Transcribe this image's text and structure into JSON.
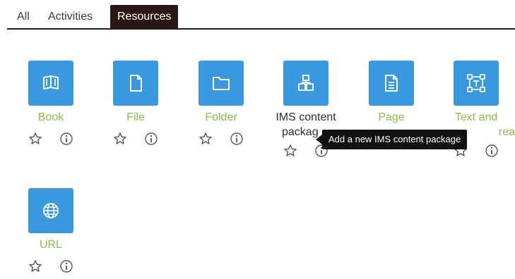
{
  "tabs": [
    {
      "label": "All"
    },
    {
      "label": "Activities"
    },
    {
      "label": "Resources"
    }
  ],
  "active_tab": "Resources",
  "tiles": [
    {
      "label": "Book",
      "icon": "book-icon"
    },
    {
      "label": "File",
      "icon": "file-icon"
    },
    {
      "label": "Folder",
      "icon": "folder-icon"
    },
    {
      "label_line1": "IMS content",
      "label_line2": "packag",
      "icon": "ims-package-icon"
    },
    {
      "label": "Page",
      "icon": "page-icon"
    },
    {
      "label_line1": "Text and",
      "label_line2": "rea",
      "icon": "text-area-icon"
    },
    {
      "label": "URL",
      "icon": "globe-icon"
    }
  ],
  "action_icons": [
    "star-outline-icon",
    "info-circle-icon"
  ],
  "tooltip": {
    "text": "Add a new IMS content package"
  },
  "colors": {
    "tile_bg": "#3a98df",
    "label_green": "#8dbd48",
    "active_tab_bg": "#2a1614",
    "tooltip_bg": "#111111"
  }
}
